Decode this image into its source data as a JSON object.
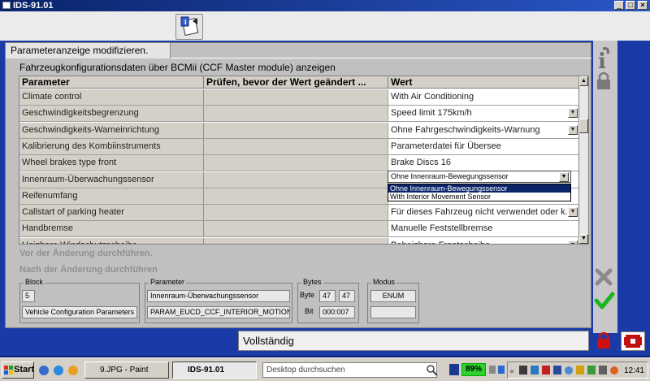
{
  "window": {
    "title": "IDS-91.01"
  },
  "tab": {
    "label": "Parameteranzeige modifizieren."
  },
  "heading": "Fahrzeugkonfigurationsdaten über BCMii (CCF Master module) anzeigen",
  "table": {
    "columns": [
      "Parameter",
      "Prüfen, bevor der Wert geändert ...",
      "Wert"
    ],
    "rows": [
      {
        "parameter": "Climate control",
        "check": "",
        "value": "With Air Conditioning",
        "dropdown": false
      },
      {
        "parameter": "Geschwindigkeitsbegrenzung",
        "check": "",
        "value": "Speed limit 175km/h",
        "dropdown": true
      },
      {
        "parameter": "Geschwindigkeits-Warneinrichtung",
        "check": "",
        "value": "Ohne Fahrgeschwindigkeits-Warnung",
        "dropdown": true
      },
      {
        "parameter": "Kalibrierung des Kombiinstruments",
        "check": "",
        "value": "Parameterdatei für Übersee",
        "dropdown": false
      },
      {
        "parameter": "Wheel brakes type front",
        "check": "",
        "value": "Brake Discs 16",
        "dropdown": false
      },
      {
        "parameter": "Innenraum-Überwachungssensor",
        "check": "",
        "value": "",
        "dropdown": false
      },
      {
        "parameter": "Reifenumfang",
        "check": "",
        "value": "",
        "dropdown": false
      },
      {
        "parameter": "Callstart of parking heater",
        "check": "",
        "value": "Für dieses Fahrzeug nicht verwendet oder k...",
        "dropdown": true
      },
      {
        "parameter": "Handbremse",
        "check": "",
        "value": "Manuelle Feststellbremse",
        "dropdown": false
      },
      {
        "parameter": "Heizbare Windschutzscheibe",
        "check": "",
        "value": "Beheizbare Frontscheibe",
        "dropdown": true
      }
    ],
    "open_dropdown": {
      "current": "Ohne Innenraum-Bewegungssensor",
      "options": [
        "Ohne Innenraum-Bewegungssensor",
        "With Interior Movement Sensor"
      ],
      "selected_index": 0
    }
  },
  "notes": {
    "before": "Vor der Änderung durchführen.",
    "after": "Nach der Änderung durchführen"
  },
  "block": {
    "label": "Block",
    "number": "5",
    "name": "Vehicle Configuration Parameters"
  },
  "parameter": {
    "label": "Parameter",
    "name": "Innenraum-Überwachungssensor",
    "id": "PARAM_EUCD_CCF_INTERIOR_MOTION_S"
  },
  "bytes": {
    "label": "Bytes",
    "byte_label": "Byte",
    "byte1": "47",
    "byte2": "47",
    "bit_label": "Bit",
    "bit": "000:007"
  },
  "modus": {
    "label": "Modus",
    "value": "ENUM",
    "value2": ""
  },
  "status": "Vollständig",
  "taskbar": {
    "start": "Start",
    "tasks": [
      "9.JPG - Paint",
      "IDS-91.01"
    ],
    "search_placeholder": "Desktop durchsuchen",
    "battery": "89%",
    "clock": "12:41"
  },
  "colors": {
    "accent": "#0a246a",
    "ok_green": "#1db51d",
    "cancel_gray": "#8a8a8a",
    "lock_red": "#d01010"
  }
}
